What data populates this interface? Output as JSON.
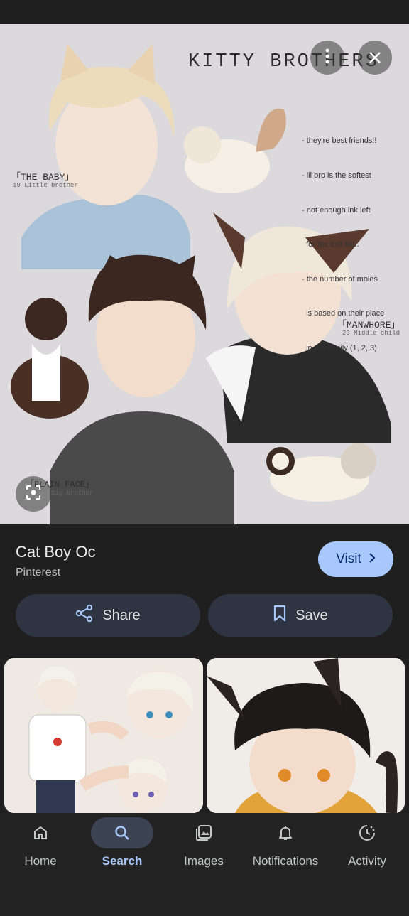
{
  "hero": {
    "artwork_title": "KITTY BROTHERS",
    "notes": [
      "- they're best friends!!",
      "- lil bro is the softest",
      "- not enough ink left",
      "  for the lost kid..",
      "- the number of moles",
      "  is based on their place",
      "  in the family (1, 2, 3)"
    ],
    "label_baby": "「THE BABY」",
    "label_baby_sub": "19 Little brother",
    "label_manwhore": "「MANWHORE」",
    "label_manwhore_sub": "23 Middle child",
    "label_plain": "「PLAIN FACE」",
    "label_plain_sub": "Big brother",
    "more_icon": "more-vert-icon",
    "close_icon": "close-icon",
    "lens_icon": "lens-icon"
  },
  "result": {
    "title": "Cat Boy Oc",
    "source": "Pinterest",
    "visit_label": "Visit",
    "share_label": "Share",
    "save_label": "Save"
  },
  "nav": {
    "items": [
      {
        "label": "Home",
        "icon": "home-icon"
      },
      {
        "label": "Search",
        "icon": "search-icon"
      },
      {
        "label": "Images",
        "icon": "images-icon"
      },
      {
        "label": "Notifications",
        "icon": "bell-icon"
      },
      {
        "label": "Activity",
        "icon": "activity-icon"
      }
    ],
    "active_index": 1
  },
  "colors": {
    "accent": "#a8c7fa",
    "background": "#1f1f1f",
    "pill": "#2e3441"
  }
}
